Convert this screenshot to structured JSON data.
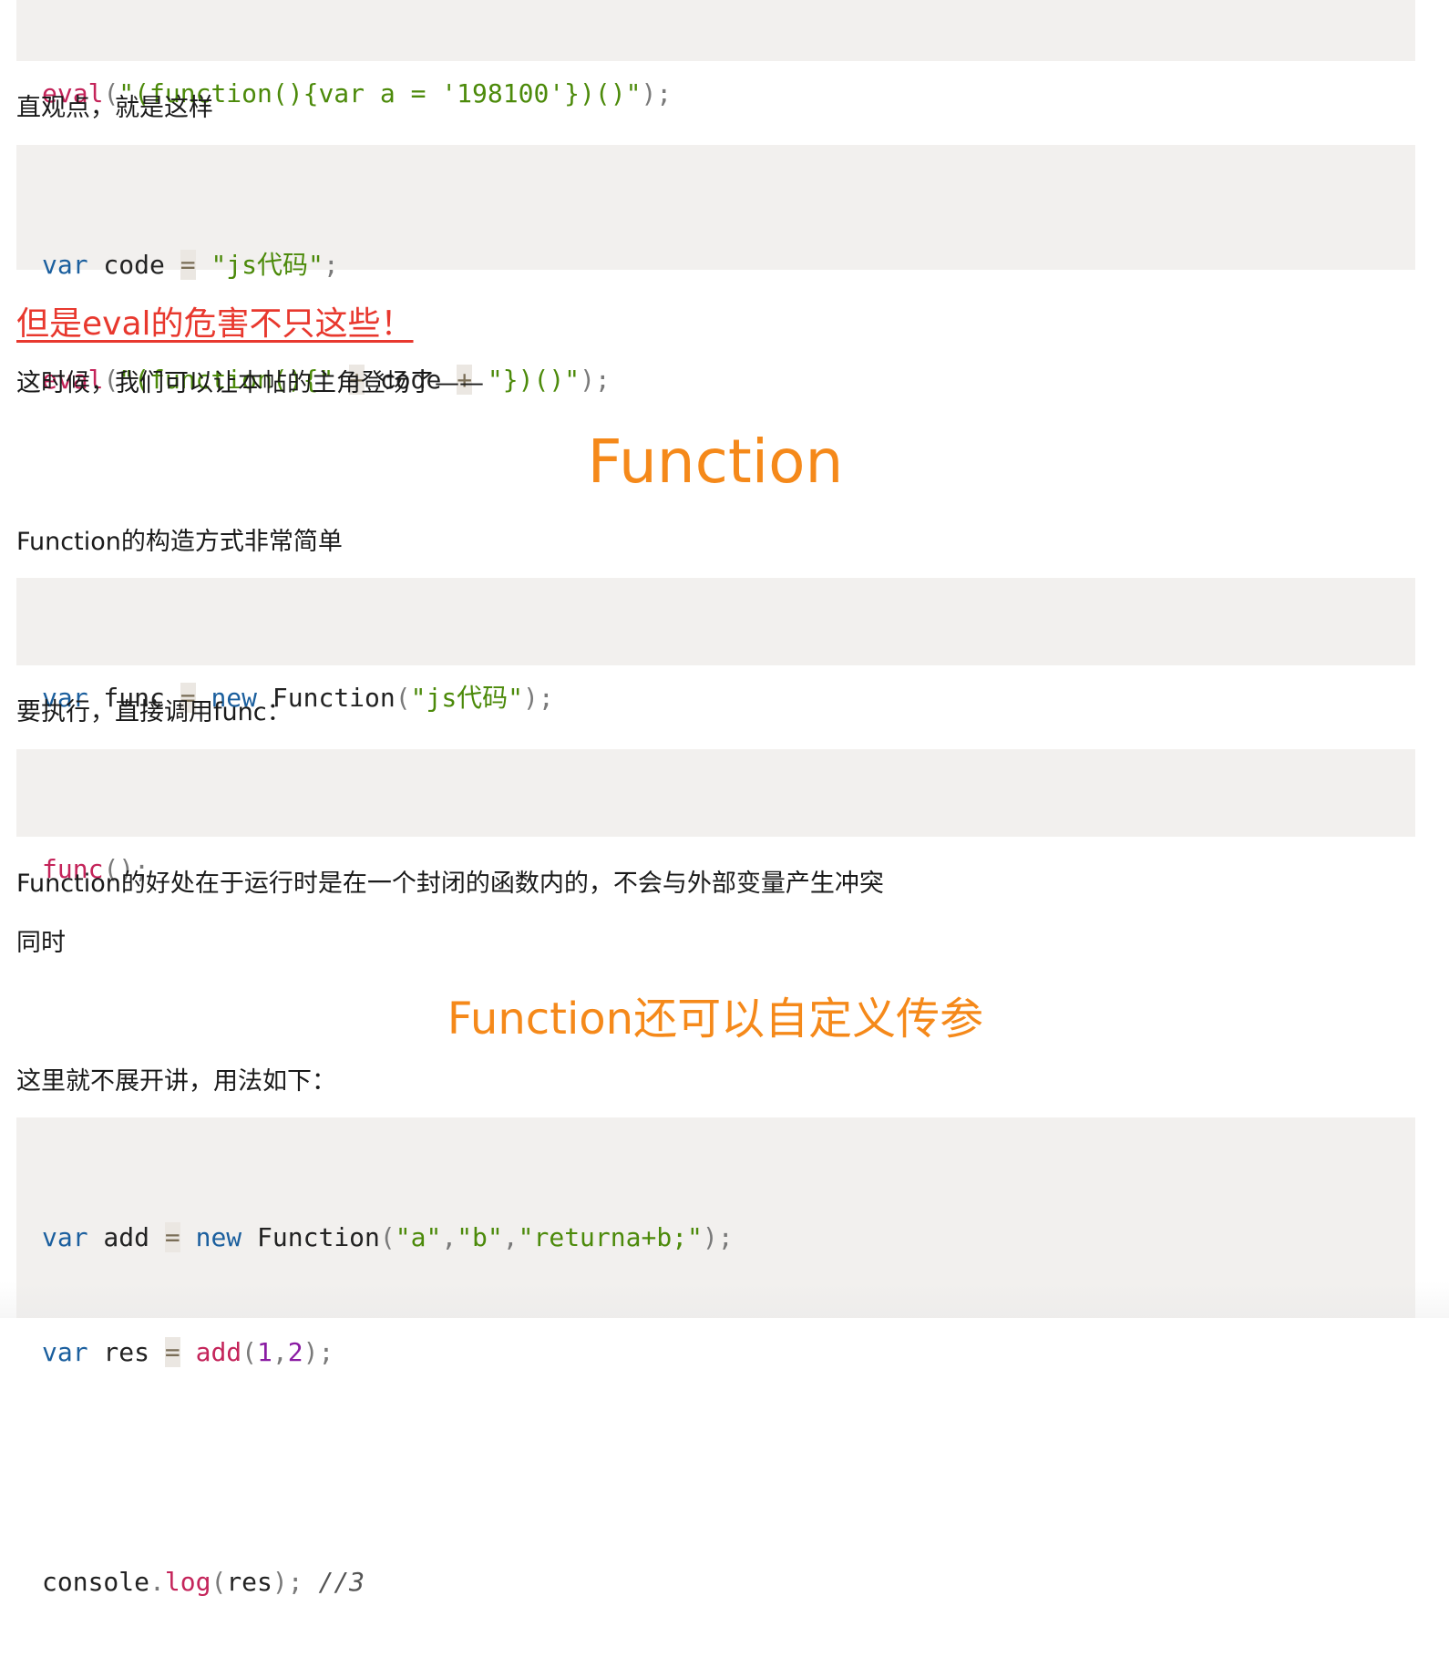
{
  "code1": {
    "l1": {
      "a": "eval",
      "b": "(",
      "c": "\"(function(){var a = '198100'})()\"",
      "d": ");"
    }
  },
  "p1": "直观点，就是这样",
  "code2": {
    "l1": {
      "a": "var",
      "b": " code ",
      "c": "=",
      "d": " ",
      "e": "\"js代码\"",
      "f": ";"
    },
    "l2": {
      "a": "eval",
      "b": "(",
      "c": "\"(function(){\"",
      "d": " ",
      "e": "+",
      "f": " code ",
      "g": "+",
      "h": " ",
      "i": "\"})()\"",
      "j": ");"
    }
  },
  "warning": "但是eval的危害不只这些！",
  "p2": "这时候，我们可以让本帖的主角登场了——",
  "heading1": "Function",
  "p3": "Function的构造方式非常简单",
  "code3": {
    "l1": {
      "a": "var",
      "b": " func ",
      "c": "=",
      "d": " ",
      "e": "new",
      "f": " Function",
      "g": "(",
      "h": "\"js代码\"",
      "i": ");"
    }
  },
  "p4": "要执行，直接调用func：",
  "code4": {
    "l1": {
      "a": "func",
      "b": "();"
    }
  },
  "p5": "Function的好处在于运行时是在一个封闭的函数内的，不会与外部变量产生冲突",
  "p6": "同时",
  "heading2": "Function还可以自定义传参",
  "p7": "这里就不展开讲，用法如下：",
  "code5": {
    "l1": {
      "a": "var",
      "b": " add ",
      "c": "=",
      "d": " ",
      "e": "new",
      "f": " Function",
      "g": "(",
      "h": "\"a\"",
      "i": ",",
      "j": "\"b\"",
      "k": ",",
      "l": "\"returna+b;\"",
      "m": ");"
    },
    "l2": {
      "a": "var",
      "b": " res ",
      "c": "=",
      "d": " ",
      "e": "add",
      "f": "(",
      "g": "1",
      "h": ",",
      "i": "2",
      "j": ");"
    },
    "l4": {
      "a": "console",
      "b": ".",
      "c": "log",
      "d": "(",
      "e": "res",
      "f": ");",
      "g": " ",
      "h": "//3"
    }
  }
}
